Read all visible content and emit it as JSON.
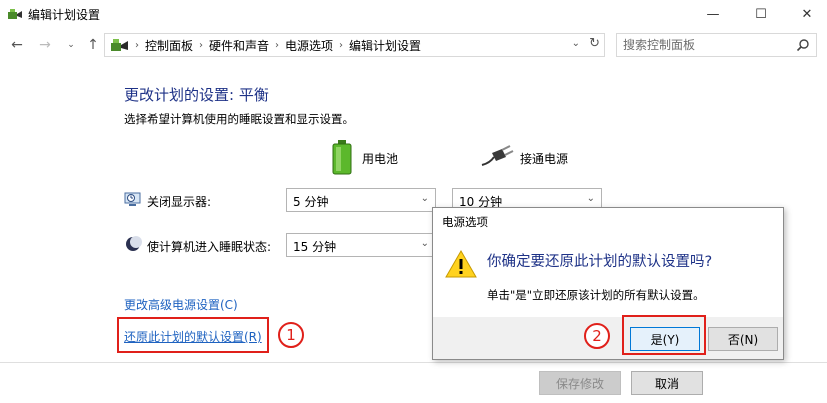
{
  "window": {
    "title": "编辑计划设置",
    "minimize_glyph": "—",
    "maximize_glyph": "☐",
    "close_glyph": "✕"
  },
  "nav": {
    "back_glyph": "←",
    "forward_glyph": "→",
    "recent_glyph": "⌄",
    "up_glyph": "↑",
    "breadcrumbs": [
      "控制面板",
      "硬件和声音",
      "电源选项",
      "编辑计划设置"
    ],
    "breadcrumb_separator": "›",
    "dropdown_glyph": "⌄",
    "refresh_glyph": "↻",
    "search_placeholder": "搜索控制面板"
  },
  "main": {
    "heading": "更改计划的设置: 平衡",
    "subheading": "选择希望计算机使用的睡眠设置和显示设置。",
    "columns": {
      "battery": "用电池",
      "plugged_in": "接通电源"
    },
    "rows": [
      {
        "label": "关闭显示器:",
        "battery_value": "5 分钟",
        "plugged_value": "10 分钟",
        "icon": "monitor-clock-icon"
      },
      {
        "label": "使计算机进入睡眠状态:",
        "battery_value": "15 分钟",
        "icon": "moon-icon"
      }
    ],
    "chevron_glyph": "⌄",
    "advanced_link": "更改高级电源设置(C)",
    "restore_link": "还原此计划的默认设置(R)",
    "save_button": "保存修改",
    "cancel_button": "取消"
  },
  "dialog": {
    "title": "电源选项",
    "question": "你确定要还原此计划的默认设置吗?",
    "detail": "单击\"是\"立即还原该计划的所有默认设置。",
    "yes_button": "是(Y)",
    "no_button": "否(N)"
  },
  "annotations": {
    "step1": "1",
    "step2": "2",
    "highlight_color": "#e0201a"
  },
  "colors": {
    "heading": "#1e3287",
    "link": "#1e62c0",
    "accent": "#0078d7"
  }
}
